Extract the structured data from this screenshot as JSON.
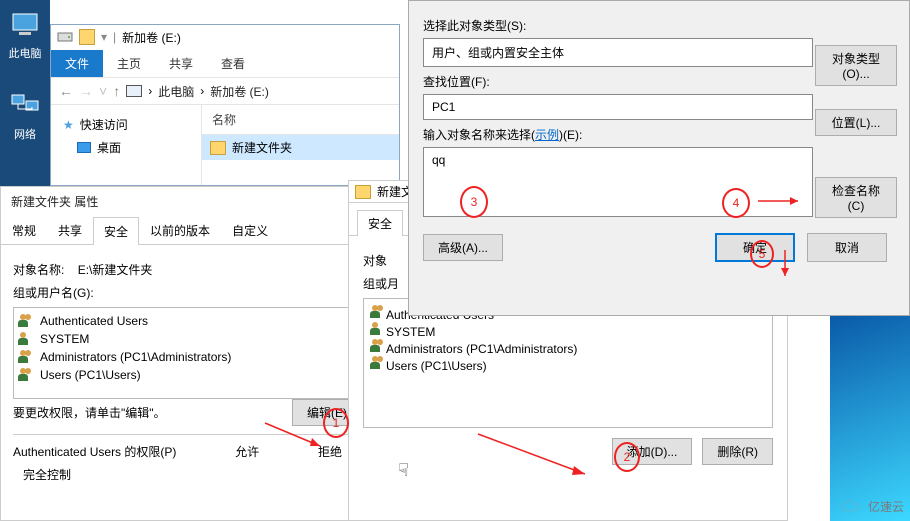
{
  "desktop": {
    "this_pc": "此电脑",
    "network": "网络"
  },
  "explorer": {
    "volume": "新加卷 (E:)",
    "file_tab": "文件",
    "home_tab": "主页",
    "share_tab": "共享",
    "view_tab": "查看",
    "crumb_pc": "此电脑",
    "crumb_vol": "新加卷 (E:)",
    "quick_access": "快速访问",
    "desktop": "桌面",
    "col_name": "名称",
    "folder": "新建文件夹"
  },
  "props": {
    "title": "新建文件夹 属性",
    "tab_general": "常规",
    "tab_share": "共享",
    "tab_security": "安全",
    "tab_prev": "以前的版本",
    "tab_custom": "自定义",
    "obj_label": "对象名称:",
    "obj_value": "E:\\新建文件夹",
    "group_label": "组或用户名(G):",
    "users": [
      "Authenticated Users",
      "SYSTEM",
      "Administrators (PC1\\Administrators)",
      "Users (PC1\\Users)"
    ],
    "edit_hint": "要更改权限，请单击\"编辑\"。",
    "edit_btn": "编辑(E)",
    "perm_for": "Authenticated Users 的权限(P)",
    "allow": "允许",
    "deny": "拒绝",
    "full_control": "完全控制"
  },
  "perm": {
    "title": "新建文",
    "tab_security": "安全",
    "obj_label": "对象",
    "group_label": "组或月",
    "users": [
      "Authenticated Users",
      "SYSTEM",
      "Administrators (PC1\\Administrators)",
      "Users (PC1\\Users)"
    ],
    "add_btn": "添加(D)...",
    "remove_btn": "删除(R)"
  },
  "sel": {
    "type_label": "选择此对象类型(S):",
    "type_value": "用户、组或内置安全主体",
    "type_btn": "对象类型(O)...",
    "loc_label": "查找位置(F):",
    "loc_value": "PC1",
    "loc_btn": "位置(L)...",
    "name_label_1": "输入对象名称来选择(",
    "name_label_link": "示例",
    "name_label_2": ")(E):",
    "name_value": "qq",
    "check_btn": "检查名称(C)",
    "adv_btn": "高级(A)...",
    "ok_btn": "确定",
    "cancel_btn": "取消"
  },
  "anno": {
    "n1": "1",
    "n2": "2",
    "n3": "3",
    "n4": "4",
    "n5": "5"
  },
  "watermark": "亿速云"
}
